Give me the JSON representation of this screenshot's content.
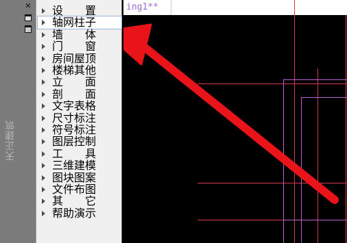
{
  "strip": {
    "title": "天正建筑",
    "close": "✕"
  },
  "menu": {
    "items": [
      {
        "label": "设　　置"
      },
      {
        "label": "轴网柱子"
      },
      {
        "label": "墙　　体"
      },
      {
        "label": "门　　窗"
      },
      {
        "label": "房间屋顶"
      },
      {
        "label": "楼梯其他"
      },
      {
        "label": "立　　面"
      },
      {
        "label": "剖　　面"
      },
      {
        "label": "文字表格"
      },
      {
        "label": "尺寸标注"
      },
      {
        "label": "符号标注"
      },
      {
        "label": "图层控制"
      },
      {
        "label": "工　　具"
      },
      {
        "label": "三维建模"
      },
      {
        "label": "图块图案"
      },
      {
        "label": "文件布图"
      },
      {
        "label": "其　　它"
      },
      {
        "label": "帮助演示"
      }
    ],
    "selected_index": 1
  },
  "tab": {
    "title": "ing1**"
  },
  "colors": {
    "arrow": "#e8141a",
    "red_line": "#d43a4a",
    "magenta_line": "#c060d8",
    "tab_text": "#9b6bd6"
  }
}
